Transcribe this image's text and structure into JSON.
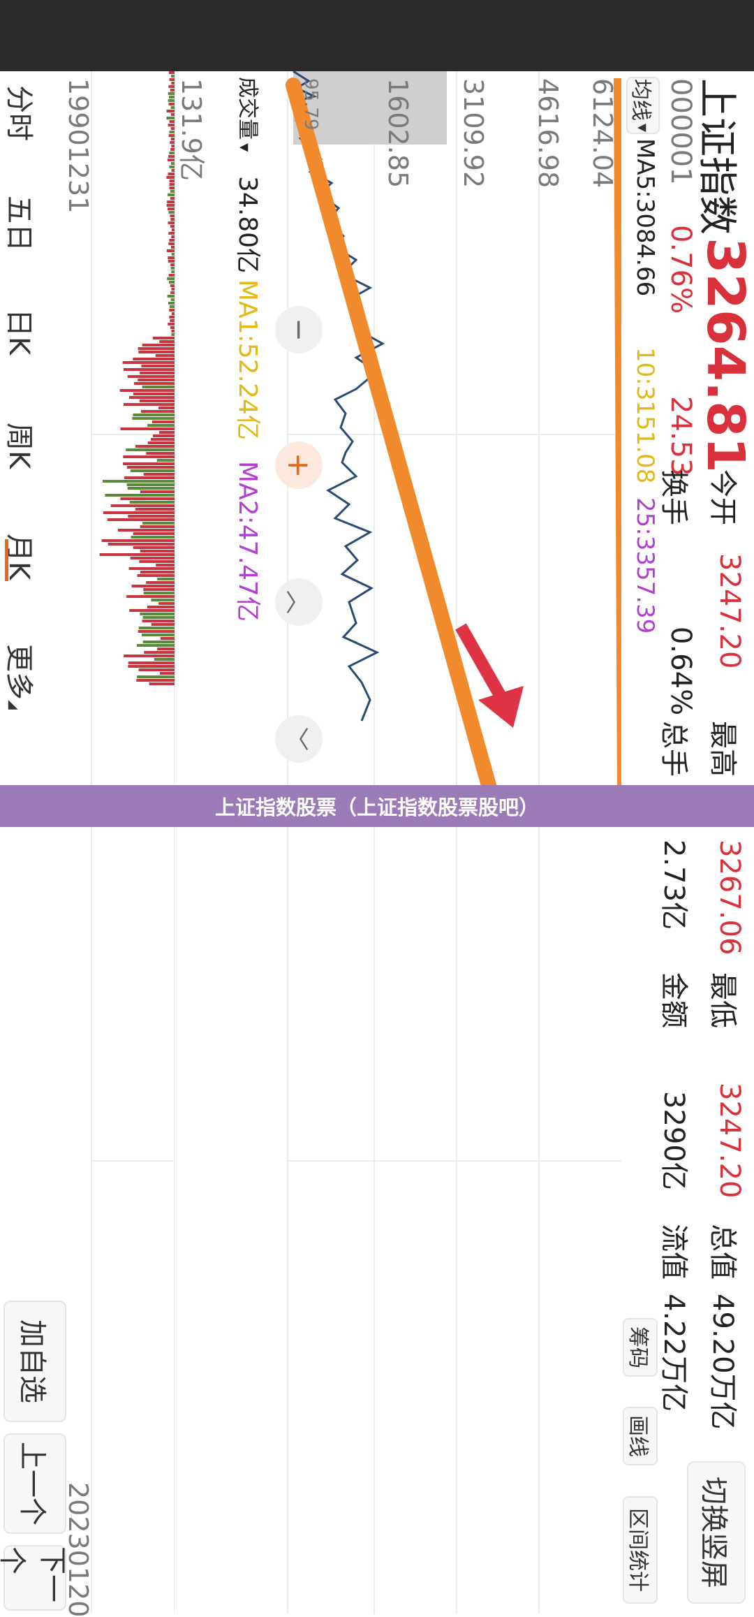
{
  "header": {
    "title": "上证指数",
    "price": "3264.81",
    "code": "000001",
    "change_pct": "0.76%",
    "change_amt": "24.53",
    "stats": [
      {
        "label": "今开",
        "value": "3247.20",
        "color": "red"
      },
      {
        "label": "最高",
        "value": "3267.06",
        "color": "red"
      },
      {
        "label": "最低",
        "value": "3247.20",
        "color": "red"
      },
      {
        "label": "总值",
        "value": "49.20万亿",
        "color": "dark"
      }
    ],
    "stats2": [
      {
        "label": "换手",
        "value": "0.64%"
      },
      {
        "label": "总手",
        "value": "2.73亿"
      },
      {
        "label": "金额",
        "value": "3290亿"
      },
      {
        "label": "流值",
        "value": "4.22万亿"
      }
    ],
    "switch_button": "切换竖屏",
    "tool_buttons": [
      "筹码",
      "画线",
      "区间统计"
    ]
  },
  "indicator": {
    "dropdown": "均线",
    "ma5": "MA5:3084.66",
    "ma10": "10:3151.08",
    "ma25": "25:3357.39"
  },
  "price_axis": [
    "6124.04",
    "4616.98",
    "3109.92",
    "1602.85",
    "95.79"
  ],
  "volume": {
    "dropdown": "成交量",
    "value": "34.80亿",
    "ma1": "MA1:52.24亿",
    "ma2": "MA2:47.47亿",
    "axis_top": "131.9亿"
  },
  "dates": {
    "start": "19901231",
    "end": "20230120"
  },
  "tabs": [
    {
      "label": "分时",
      "active": false
    },
    {
      "label": "五日",
      "active": false
    },
    {
      "label": "日K",
      "active": false
    },
    {
      "label": "周K",
      "active": false
    },
    {
      "label": "月K",
      "active": true
    },
    {
      "label": "更多",
      "active": false
    }
  ],
  "bottom_buttons": [
    "下一个",
    "上一个",
    "加自选"
  ],
  "zoom_buttons": [
    "zoom-out-icon",
    "zoom-in-icon",
    "chevron-up-icon",
    "chevron-down-icon"
  ],
  "banner": "上证指数股票（上证指数股票股吧）",
  "colors": {
    "accent": "#d8313b",
    "ma10": "#e3b714",
    "ma25": "#b23fd4",
    "line": "#2b4a73",
    "overlay": "#f08a2c",
    "banner": "#9a7bb8"
  }
}
